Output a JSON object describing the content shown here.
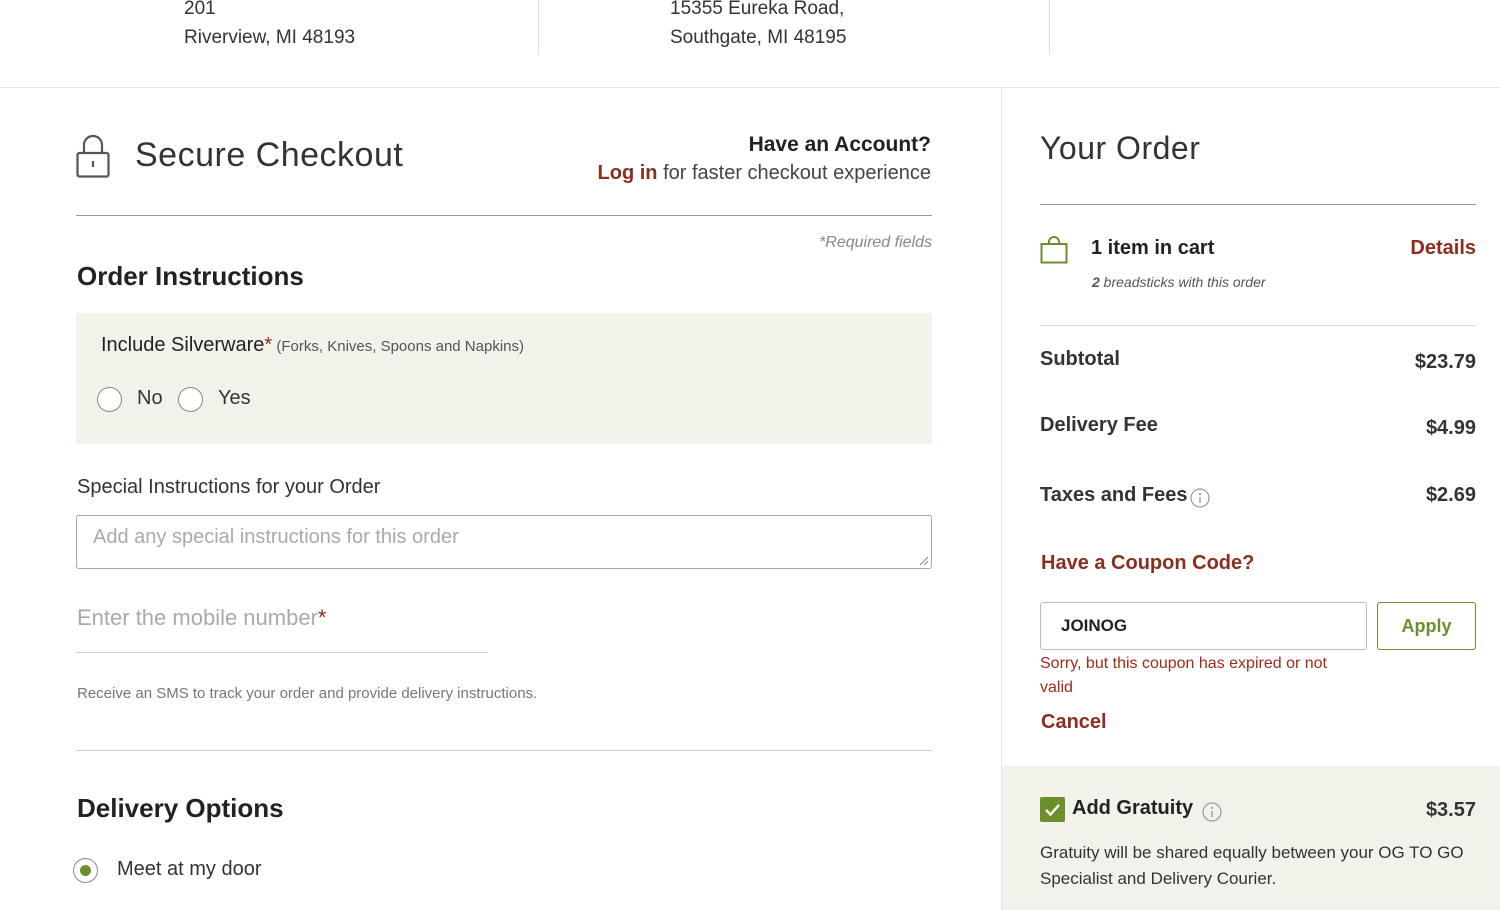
{
  "stores": [
    {
      "line1": "201",
      "line2": "Riverview, MI 48193"
    },
    {
      "line1": "15355 Eureka Road,",
      "line2": "Southgate, MI 48195"
    }
  ],
  "checkout": {
    "title": "Secure Checkout",
    "have_account": "Have an Account?",
    "login_link": "Log in",
    "login_suffix": " for faster checkout experience",
    "required_note": "*Required fields"
  },
  "order_instructions": {
    "heading": "Order Instructions",
    "silverware_label": "Include Silverware",
    "required_star": "*",
    "silverware_sub": " (Forks, Knives, Spoons and Napkins)",
    "option_no": "No",
    "option_yes": "Yes",
    "special_label": "Special Instructions for your Order",
    "special_placeholder": "Add any special instructions for this order",
    "mobile_placeholder": "Enter the mobile number",
    "sms_note": "Receive an SMS to track your order and provide delivery instructions."
  },
  "delivery": {
    "heading": "Delivery Options",
    "option_meet": "Meet at my door"
  },
  "order": {
    "title": "Your Order",
    "cart_count": "1 item in cart",
    "details_link": "Details",
    "breadsticks_count": "2",
    "breadsticks_text": " breadsticks with this order",
    "subtotal_label": "Subtotal",
    "subtotal_value": "$23.79",
    "delivery_fee_label": "Delivery Fee",
    "delivery_fee_value": "$4.99",
    "taxes_label": "Taxes and Fees",
    "taxes_value": "$2.69",
    "coupon_link": "Have a Coupon Code?",
    "coupon_value": "JOINOG",
    "apply_label": "Apply",
    "coupon_error": "Sorry, but this coupon has expired or not valid",
    "cancel_label": "Cancel",
    "gratuity_label": "Add Gratuity",
    "gratuity_value": "$3.57",
    "gratuity_note": "Gratuity will be shared equally between your OG TO GO Specialist and Delivery Courier."
  },
  "colors": {
    "accent_red": "#8b2e1d",
    "accent_green": "#6b8f2b",
    "panel_bg": "#f2f2eb"
  }
}
